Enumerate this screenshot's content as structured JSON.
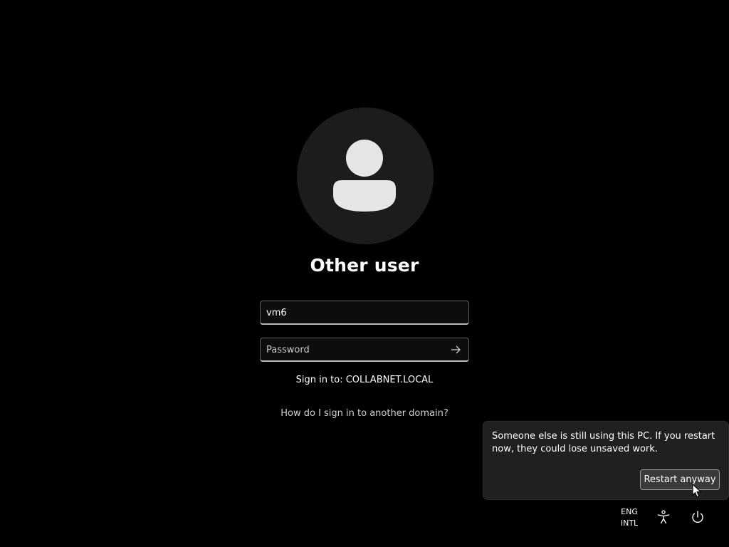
{
  "login": {
    "user_display_name": "Other user",
    "username_value": "vm6",
    "password_placeholder": "Password",
    "sign_in_to": "Sign in to: COLLABNET.LOCAL",
    "other_domain_link": "How do I sign in to another domain?"
  },
  "toast": {
    "message": "Someone else is still using this PC. If you restart now, they could lose unsaved work.",
    "restart_button": "Restart anyway"
  },
  "tray": {
    "lang_line1": "ENG",
    "lang_line2": "INTL",
    "icons": [
      "accessibility-icon",
      "power-icon"
    ]
  },
  "colors": {
    "background": "#000000",
    "avatar_circle": "#1c1c1c",
    "avatar_figure": "#e6e6e6",
    "toast_bg": "#202020",
    "button_bg": "#3a3a3a"
  }
}
